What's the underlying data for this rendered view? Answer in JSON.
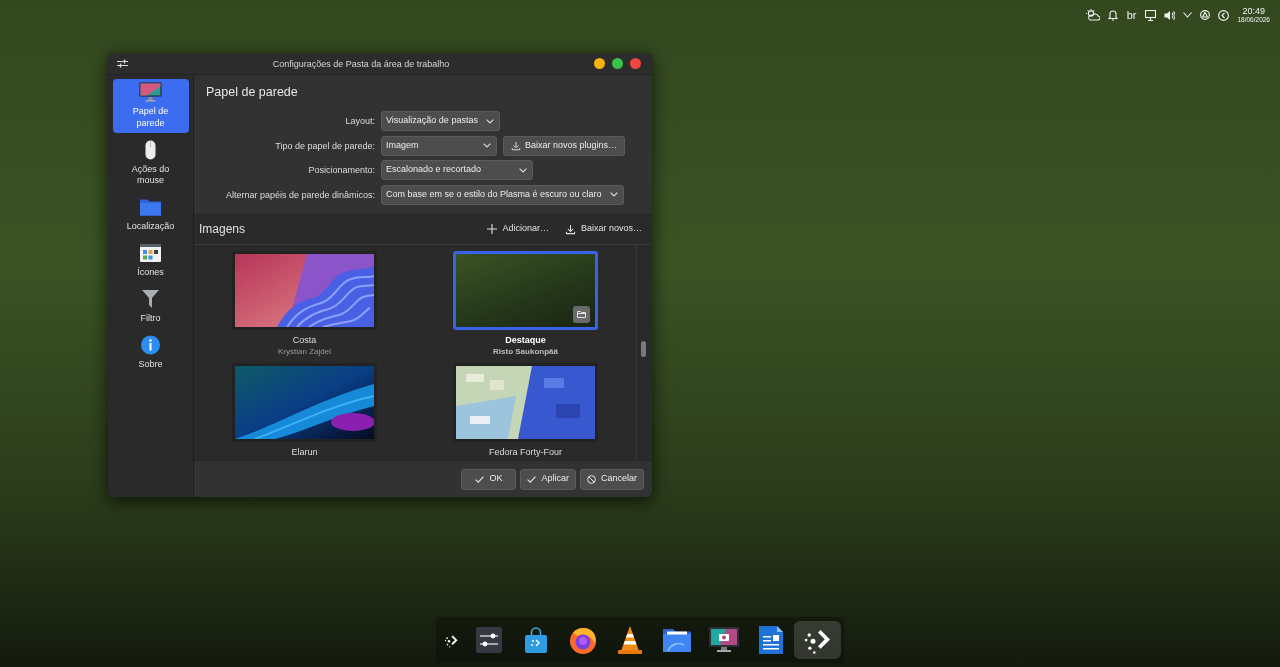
{
  "window": {
    "title": "Configurações de Pasta da área de trabalho"
  },
  "sidebar": {
    "items": [
      {
        "label": "Papel de parede",
        "selected": true
      },
      {
        "label": "Ações do mouse",
        "selected": false
      },
      {
        "label": "Localização",
        "selected": false
      },
      {
        "label": "Ícones",
        "selected": false
      },
      {
        "label": "Filtro",
        "selected": false
      },
      {
        "label": "Sobre",
        "selected": false
      }
    ]
  },
  "page": {
    "heading": "Papel de parede",
    "fields": [
      {
        "label": "Layout:",
        "value": "Visualização de pastas"
      },
      {
        "label": "Tipo de papel de parede:",
        "value": "Imagem",
        "button": "Baixar novos plugins…"
      },
      {
        "label": "Posicionamento:",
        "value": "Escalonado e recortado"
      },
      {
        "label": "Alternar papéis de parede dinâmicos:",
        "value": "Com base em se o estilo do Plasma é escuro ou claro"
      }
    ]
  },
  "images": {
    "title": "Imagens",
    "actions": [
      {
        "label": "Adicionar…",
        "kind": "add"
      },
      {
        "label": "Baixar novos…",
        "kind": "download"
      }
    ],
    "items": [
      {
        "name": "Costa",
        "author": "Krystian Zajdel",
        "selected": false
      },
      {
        "name": "Destaque",
        "author": "Risto Saukonpää",
        "selected": true
      },
      {
        "name": "Elarun",
        "selected": false
      },
      {
        "name": "Fedora Forty-Four",
        "selected": false
      }
    ]
  },
  "buttons": [
    {
      "label": "OK",
      "kind": "confirm"
    },
    {
      "label": "Aplicar",
      "kind": "confirm"
    },
    {
      "label": "Cancelar",
      "kind": "cancel"
    }
  ],
  "tray": {
    "keyboard_layout": "br",
    "time": "20:49",
    "date": "18/06/2026"
  },
  "dock": {
    "items": [
      {
        "selected": false
      },
      {
        "selected": false
      },
      {
        "selected": false
      },
      {
        "selected": false
      },
      {
        "selected": false
      },
      {
        "selected": false
      },
      {
        "selected": false
      },
      {
        "selected": false
      },
      {
        "selected": true
      }
    ]
  }
}
